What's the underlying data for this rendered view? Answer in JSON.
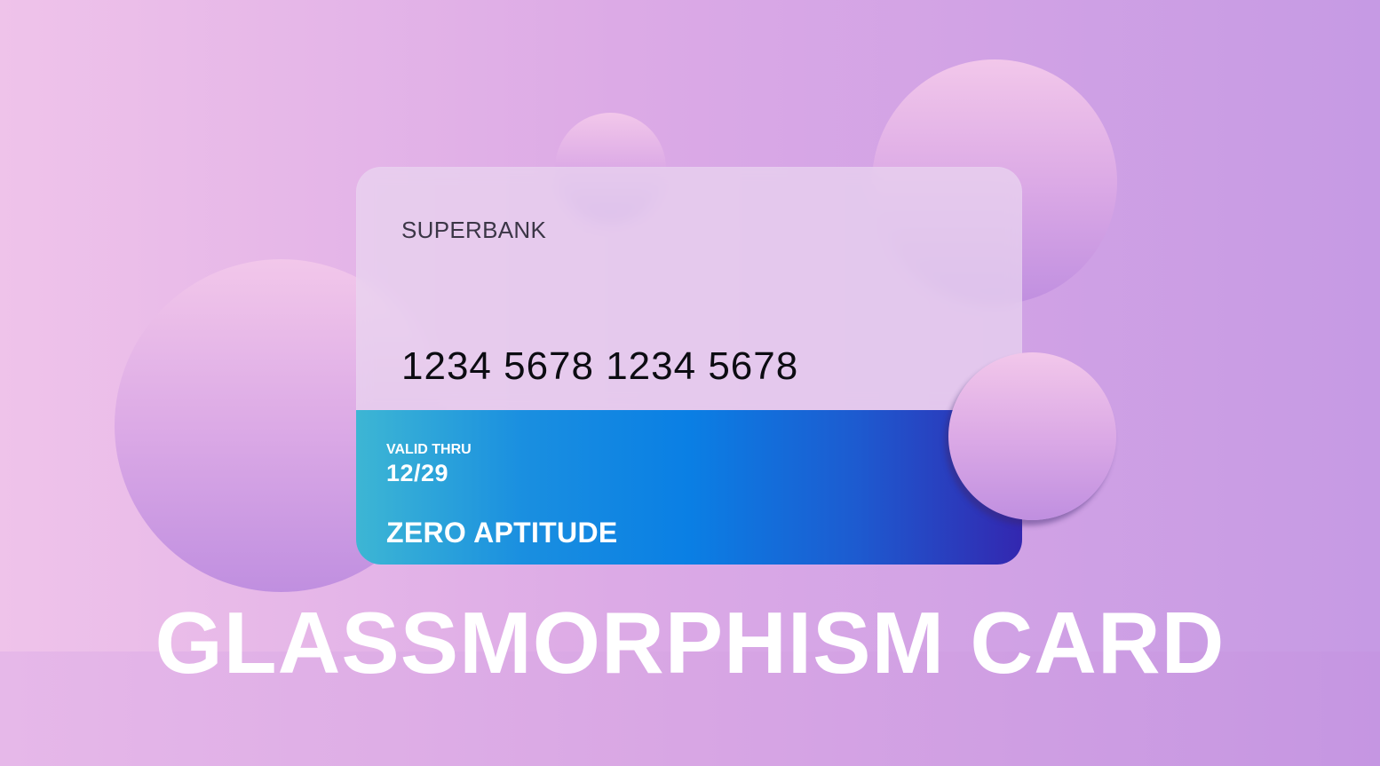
{
  "card": {
    "bank_name": "SUPERBANK",
    "number": "1234 5678 1234 5678",
    "valid_label": "VALID THRU",
    "valid_value": "12/29",
    "holder_name": "ZERO APTITUDE"
  },
  "headline": "GLASSMORPHISM CARD",
  "colors": {
    "background_start": "#efc3ea",
    "background_end": "#c69ae4",
    "stripe_start": "#3db6d4",
    "stripe_mid": "#0a7fe4",
    "stripe_end": "#3327b0",
    "text_light": "#ffffff"
  }
}
